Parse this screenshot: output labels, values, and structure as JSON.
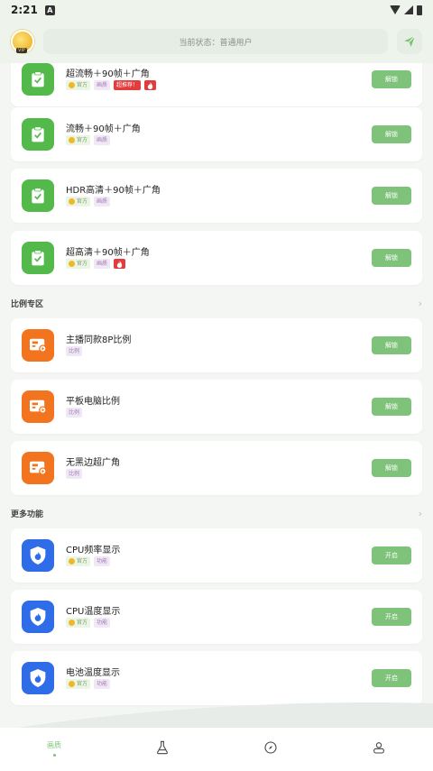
{
  "status_bar": {
    "time": "2:21",
    "notif_letter": "A"
  },
  "header": {
    "state_text": "当前状态：普通用户"
  },
  "cards": [
    {
      "title": "超流畅＋90帧＋广角",
      "official": "官方",
      "tag": "画质",
      "badge": "超推荐！",
      "fire": true,
      "action": "解锁",
      "icon": "clipboard-check-icon",
      "color": "#52b94a"
    },
    {
      "title": "流畅＋90帧＋广角",
      "official": "官方",
      "tag": "画质",
      "badge": "",
      "fire": false,
      "action": "解锁",
      "icon": "clipboard-check-icon",
      "color": "#52b94a"
    },
    {
      "title": "HDR高清＋90帧＋广角",
      "official": "官方",
      "tag": "画质",
      "badge": "",
      "fire": false,
      "action": "解锁",
      "icon": "clipboard-check-icon",
      "color": "#52b94a"
    },
    {
      "title": "超高清＋90帧＋广角",
      "official": "官方",
      "tag": "画质",
      "badge": "",
      "fire": true,
      "action": "解锁",
      "icon": "clipboard-check-icon",
      "color": "#52b94a"
    }
  ],
  "sections": {
    "ratio": {
      "title": "比例专区"
    },
    "more": {
      "title": "更多功能"
    }
  },
  "ratio_cards": [
    {
      "title": "主播同款8P比例",
      "tag": "比例",
      "action": "解锁",
      "icon": "screen-ratio-icon",
      "color": "#f3741f"
    },
    {
      "title": "平板电脑比例",
      "tag": "比例",
      "action": "解锁",
      "icon": "screen-ratio-icon",
      "color": "#f3741f"
    },
    {
      "title": "无黑边超广角",
      "tag": "比例",
      "action": "解锁",
      "icon": "screen-ratio-icon",
      "color": "#f3741f"
    }
  ],
  "more_cards": [
    {
      "title": "CPU频率显示",
      "official": "官方",
      "tag": "功能",
      "action": "开启",
      "icon": "shield-fire-icon",
      "color": "#2f6ce8"
    },
    {
      "title": "CPU温度显示",
      "official": "官方",
      "tag": "功能",
      "action": "开启",
      "icon": "shield-fire-icon",
      "color": "#2f6ce8"
    },
    {
      "title": "电池温度显示",
      "official": "官方",
      "tag": "功能",
      "action": "开启",
      "icon": "shield-fire-icon",
      "color": "#2f6ce8"
    }
  ],
  "nav": [
    {
      "label": "画质",
      "icon": "picture-quality-icon",
      "active": true
    },
    {
      "label": "",
      "icon": "flask-icon",
      "active": false
    },
    {
      "label": "",
      "icon": "compass-icon",
      "active": false
    },
    {
      "label": "",
      "icon": "user-icon",
      "active": false
    }
  ],
  "accent": "#7fc37a"
}
